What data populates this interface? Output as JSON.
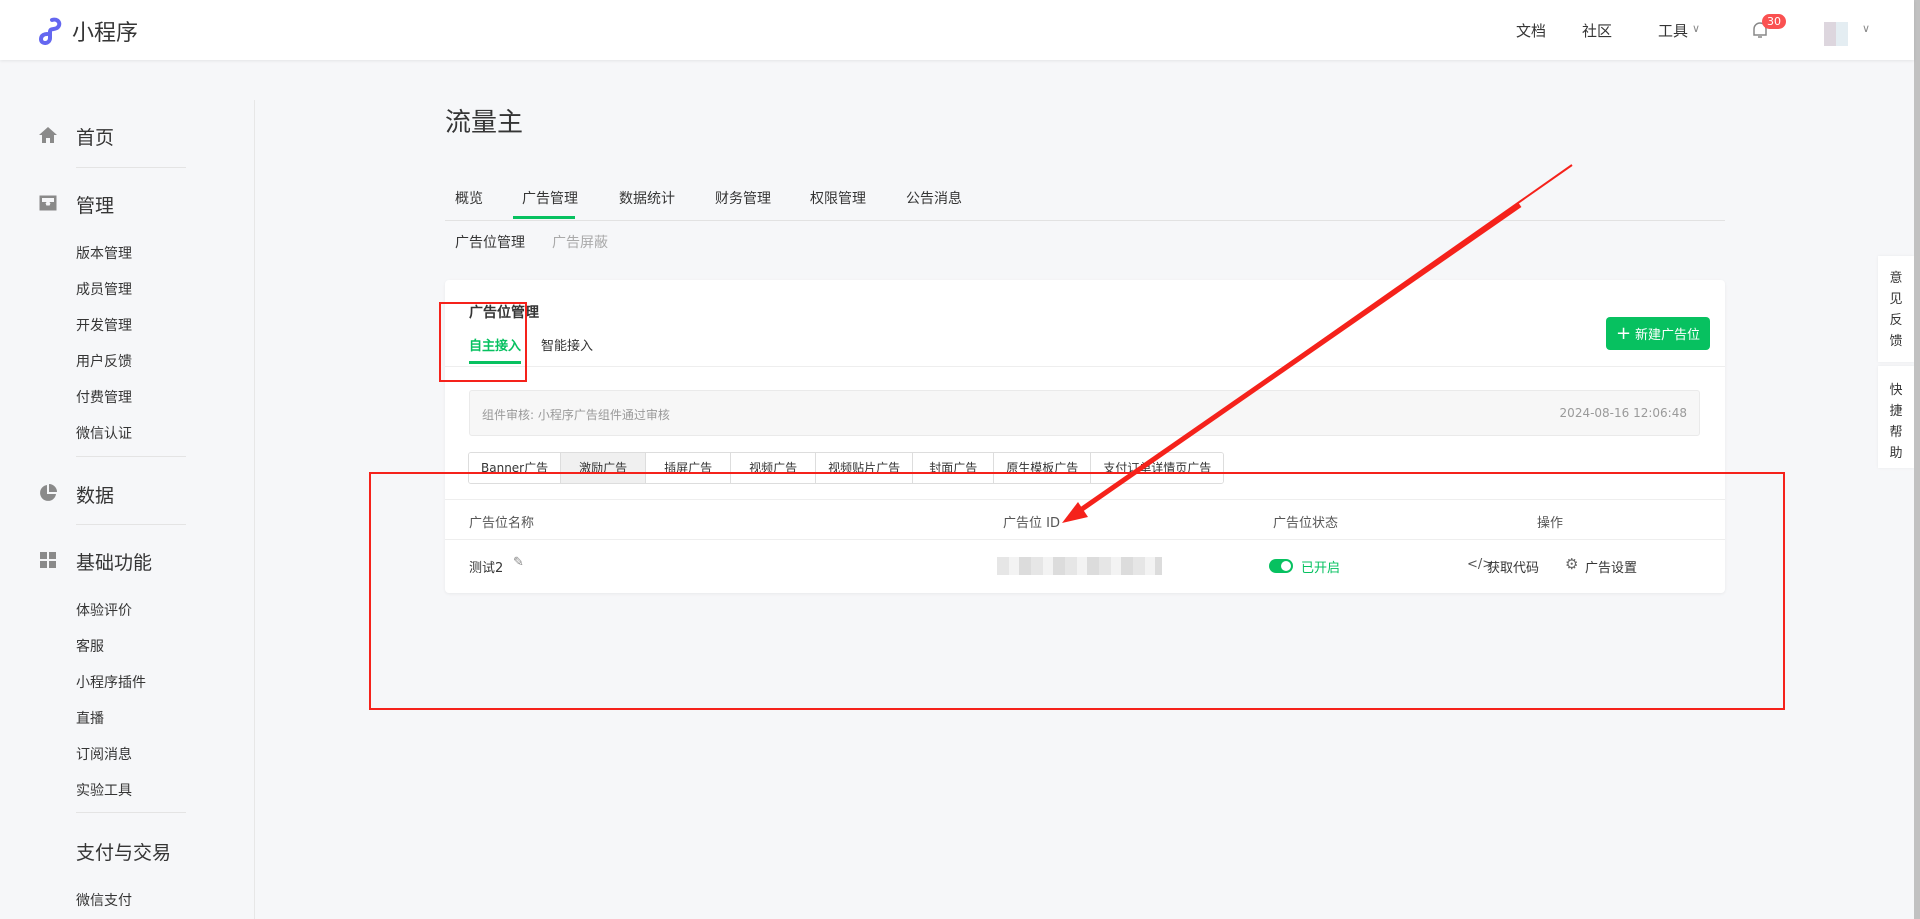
{
  "header": {
    "app_name": "小程序",
    "nav": [
      "文档",
      "社区",
      "工具"
    ],
    "notification_count": "30"
  },
  "sidebar": {
    "home": "首页",
    "manage": {
      "label": "管理",
      "items": [
        "版本管理",
        "成员管理",
        "开发管理",
        "用户反馈",
        "付费管理",
        "微信认证"
      ]
    },
    "data": "数据",
    "basic": {
      "label": "基础功能",
      "items": [
        "体验评价",
        "客服",
        "小程序插件",
        "直播",
        "订阅消息",
        "实验工具"
      ]
    },
    "pay": {
      "label": "支付与交易",
      "items": [
        "微信支付"
      ]
    }
  },
  "page": {
    "title": "流量主",
    "tabs": [
      "概览",
      "广告管理",
      "数据统计",
      "财务管理",
      "权限管理",
      "公告消息"
    ],
    "subtabs": [
      "广告位管理",
      "广告屏蔽"
    ]
  },
  "card": {
    "title": "广告位管理",
    "tabs": [
      "自主接入",
      "智能接入"
    ],
    "new_button": "新建广告位",
    "notice": {
      "text": "组件审核: 小程序广告组件通过审核",
      "time": "2024-08-16 12:06:48"
    },
    "ad_types": [
      "Banner广告",
      "激励广告",
      "插屏广告",
      "视频广告",
      "视频贴片广告",
      "封面广告",
      "原生模板广告",
      "支付订单详情页广告"
    ],
    "columns": [
      "广告位名称",
      "广告位 ID",
      "广告位状态",
      "操作"
    ],
    "rows": [
      {
        "name": "测试2",
        "status": "已开启",
        "actions": [
          "获取代码",
          "广告设置"
        ]
      }
    ]
  },
  "side_tabs": [
    "意\n见\n反\n馈",
    "快\n捷\n帮\n助"
  ],
  "colors": {
    "accent": "#07c160",
    "annotation": "#f5221b",
    "badge": "#fa5151"
  }
}
